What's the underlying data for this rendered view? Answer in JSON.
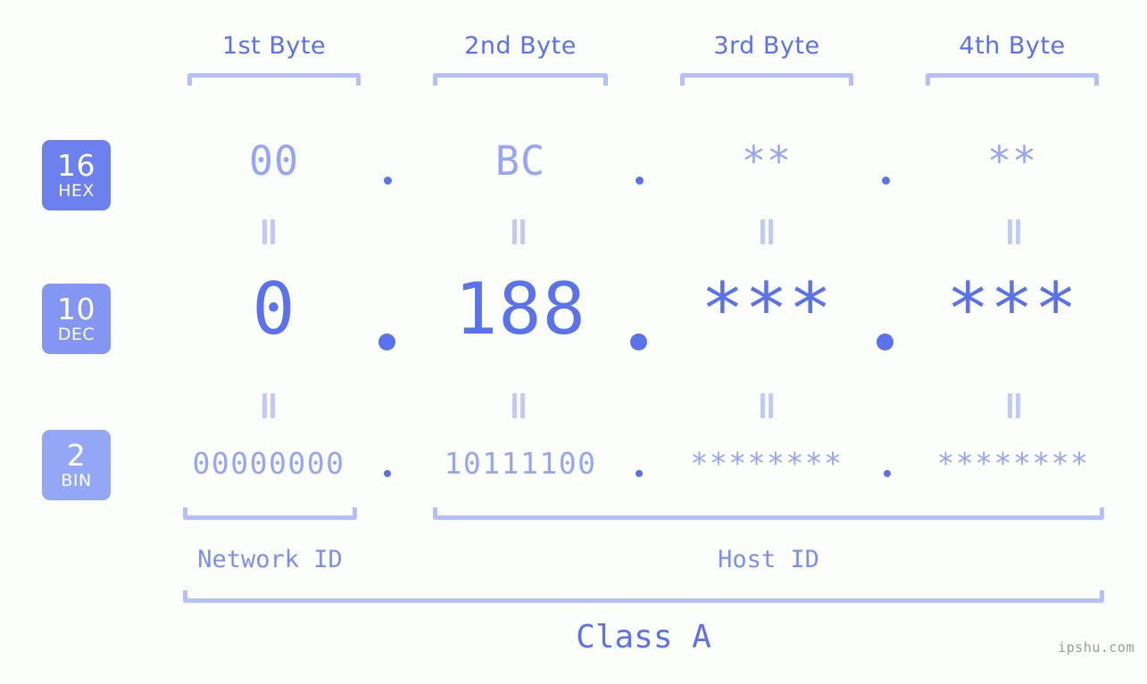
{
  "background_color": "#fcfefb",
  "accent_color": "#5a72ee",
  "accent_light_color": "#97a5f6",
  "bracket_color": "#b5bffa",
  "headers": {
    "byte1": "1st Byte",
    "byte2": "2nd Byte",
    "byte3": "3rd Byte",
    "byte4": "4th Byte"
  },
  "radix_badges": [
    {
      "number": "16",
      "name": "HEX",
      "color": "#6c80ee"
    },
    {
      "number": "10",
      "name": "DEC",
      "color": "#8496f3"
    },
    {
      "number": "2",
      "name": "BIN",
      "color": "#94a7f7"
    }
  ],
  "rows": {
    "hex": {
      "label": "HEX",
      "byte1": "00",
      "byte2": "BC",
      "byte3": "**",
      "byte4": "**",
      "separator": "."
    },
    "dec": {
      "label": "DEC",
      "byte1": "0",
      "byte2": "188",
      "byte3": "***",
      "byte4": "***",
      "separator": "."
    },
    "bin": {
      "label": "BIN",
      "byte1": "00000000",
      "byte2": "10111100",
      "byte3": "********",
      "byte4": "********",
      "separator": "."
    }
  },
  "equals_glyph": "=",
  "sections": {
    "network_id": "Network ID",
    "host_id": "Host ID",
    "ip_class": "Class A"
  },
  "watermark": "ipshu.com"
}
